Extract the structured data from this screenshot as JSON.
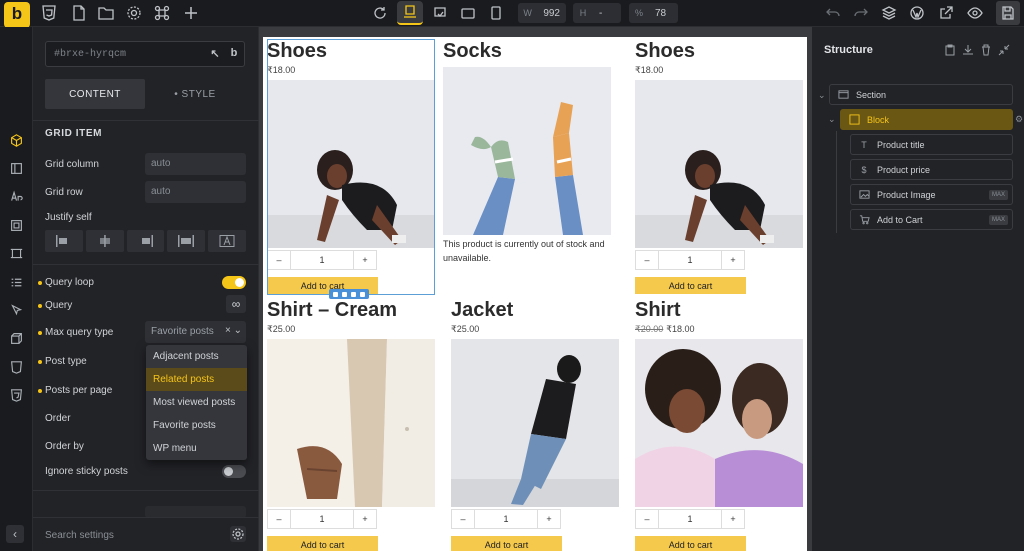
{
  "topbar": {
    "width_label": "W",
    "width_value": "992",
    "height_label": "H",
    "height_value": "-",
    "zoom_label": "%",
    "zoom_value": "78"
  },
  "logo": {
    "text": "b"
  },
  "panel": {
    "id_value": "#brxe-hyrqcm",
    "tab_content": "CONTENT",
    "tab_style": "• STYLE",
    "section_title": "GRID ITEM",
    "grid_column_label": "Grid column",
    "grid_column_value": "auto",
    "grid_row_label": "Grid row",
    "grid_row_value": "auto",
    "justify_self_label": "Justify self",
    "query_loop_label": "Query loop",
    "query_label": "Query",
    "max_query_type_label": "Max query type",
    "max_query_type_value": "Favorite posts",
    "post_type_label": "Post type",
    "posts_per_page_label": "Posts per page",
    "order_label": "Order",
    "order_by_label": "Order by",
    "ignore_sticky_label": "Ignore sticky posts",
    "dropdown_options": [
      "Adjacent posts",
      "Related posts",
      "Most viewed posts",
      "Favorite posts",
      "WP menu"
    ],
    "search_placeholder": "Search settings",
    "query_loop_on": true,
    "ignore_sticky_on": false
  },
  "products": [
    {
      "title": "Shoes",
      "price": "₹18.00",
      "old_price": "",
      "qty": "1",
      "button": "Add to cart"
    },
    {
      "title": "Socks",
      "price": "",
      "old_price": "",
      "description": "This product is currently out of stock and unavailable."
    },
    {
      "title": "Shoes",
      "price": "₹18.00",
      "old_price": "",
      "qty": "1",
      "button": "Add to cart"
    },
    {
      "title": "Shirt – Cream",
      "price": "₹25.00",
      "old_price": "",
      "qty": "1",
      "button": "Add to cart"
    },
    {
      "title": "Jacket",
      "price": "₹25.00",
      "old_price": "",
      "qty": "1",
      "button": "Add to cart"
    },
    {
      "title": "Shirt",
      "price": "₹18.00",
      "old_price": "₹20.00",
      "qty": "1",
      "button": "Add to cart"
    }
  ],
  "structure": {
    "title": "Structure",
    "items": [
      {
        "label": "Section",
        "badge": ""
      },
      {
        "label": "Block",
        "badge": ""
      },
      {
        "label": "Product title",
        "badge": ""
      },
      {
        "label": "Product price",
        "badge": ""
      },
      {
        "label": "Product Image",
        "badge": "MAX"
      },
      {
        "label": "Add to Cart",
        "badge": "MAX"
      }
    ]
  },
  "colors": {
    "accent": "#f5c518",
    "panel_bg": "#222327",
    "selection_blue": "#4a90d9",
    "button_yellow": "#f5c94c"
  }
}
